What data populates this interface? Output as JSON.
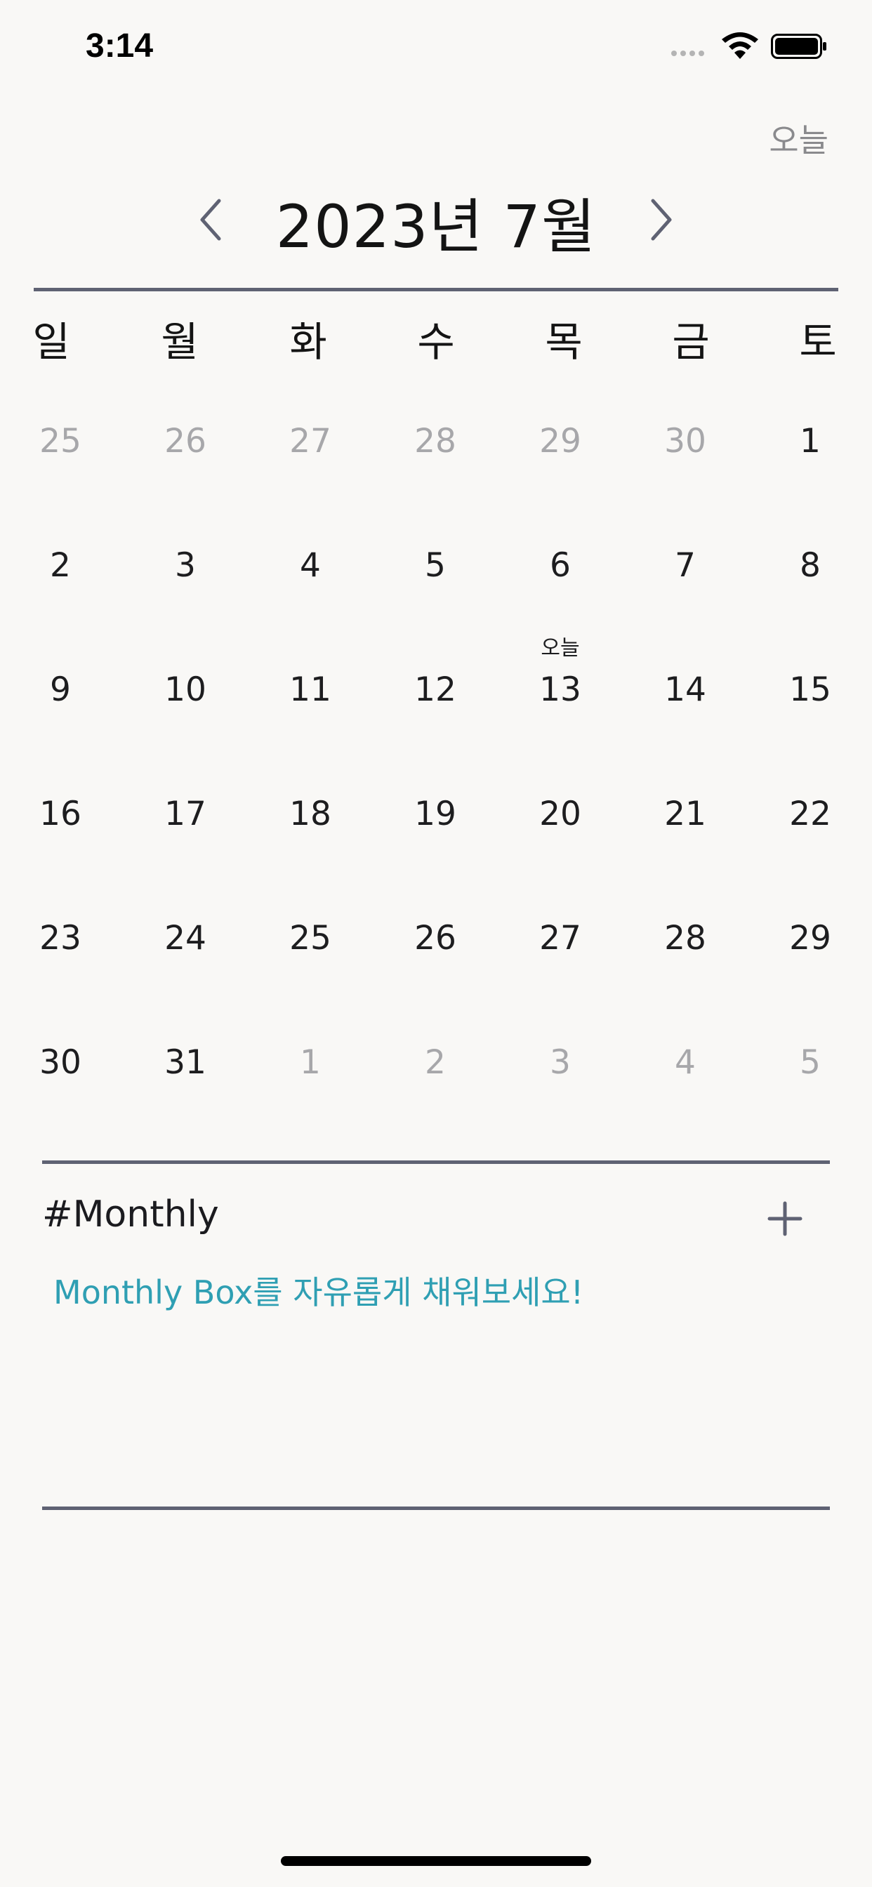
{
  "status_bar": {
    "time": "3:14",
    "icons": [
      "cellular-signal-icon",
      "wifi-icon",
      "battery-icon"
    ]
  },
  "header": {
    "today_label": "오늘",
    "title": "2023년 7월",
    "prev_icon": "chevron-left-icon",
    "next_icon": "chevron-right-icon"
  },
  "weekdays": [
    "일",
    "월",
    "화",
    "수",
    "목",
    "금",
    "토"
  ],
  "calendar": {
    "today_tag": "오늘",
    "today_date": "13",
    "weeks": [
      [
        {
          "d": "25",
          "other": true
        },
        {
          "d": "26",
          "other": true
        },
        {
          "d": "27",
          "other": true
        },
        {
          "d": "28",
          "other": true
        },
        {
          "d": "29",
          "other": true
        },
        {
          "d": "30",
          "other": true
        },
        {
          "d": "1",
          "other": false
        }
      ],
      [
        {
          "d": "2",
          "other": false
        },
        {
          "d": "3",
          "other": false
        },
        {
          "d": "4",
          "other": false
        },
        {
          "d": "5",
          "other": false
        },
        {
          "d": "6",
          "other": false
        },
        {
          "d": "7",
          "other": false
        },
        {
          "d": "8",
          "other": false
        }
      ],
      [
        {
          "d": "9",
          "other": false
        },
        {
          "d": "10",
          "other": false
        },
        {
          "d": "11",
          "other": false
        },
        {
          "d": "12",
          "other": false
        },
        {
          "d": "13",
          "other": false,
          "today": true
        },
        {
          "d": "14",
          "other": false
        },
        {
          "d": "15",
          "other": false
        }
      ],
      [
        {
          "d": "16",
          "other": false
        },
        {
          "d": "17",
          "other": false
        },
        {
          "d": "18",
          "other": false
        },
        {
          "d": "19",
          "other": false
        },
        {
          "d": "20",
          "other": false
        },
        {
          "d": "21",
          "other": false
        },
        {
          "d": "22",
          "other": false
        }
      ],
      [
        {
          "d": "23",
          "other": false
        },
        {
          "d": "24",
          "other": false
        },
        {
          "d": "25",
          "other": false
        },
        {
          "d": "26",
          "other": false
        },
        {
          "d": "27",
          "other": false
        },
        {
          "d": "28",
          "other": false
        },
        {
          "d": "29",
          "other": false
        }
      ],
      [
        {
          "d": "30",
          "other": false
        },
        {
          "d": "31",
          "other": false
        },
        {
          "d": "1",
          "other": true
        },
        {
          "d": "2",
          "other": true
        },
        {
          "d": "3",
          "other": true
        },
        {
          "d": "4",
          "other": true
        },
        {
          "d": "5",
          "other": true
        }
      ]
    ]
  },
  "monthly": {
    "title": "#Monthly",
    "placeholder": "Monthly Box를 자유롭게 채워보세요!",
    "add_icon": "plus-icon"
  },
  "colors": {
    "background": "#f9f8f6",
    "rule": "#5f6273",
    "muted_text": "#a7a7aa",
    "accent_teal": "#2f9fb3"
  }
}
